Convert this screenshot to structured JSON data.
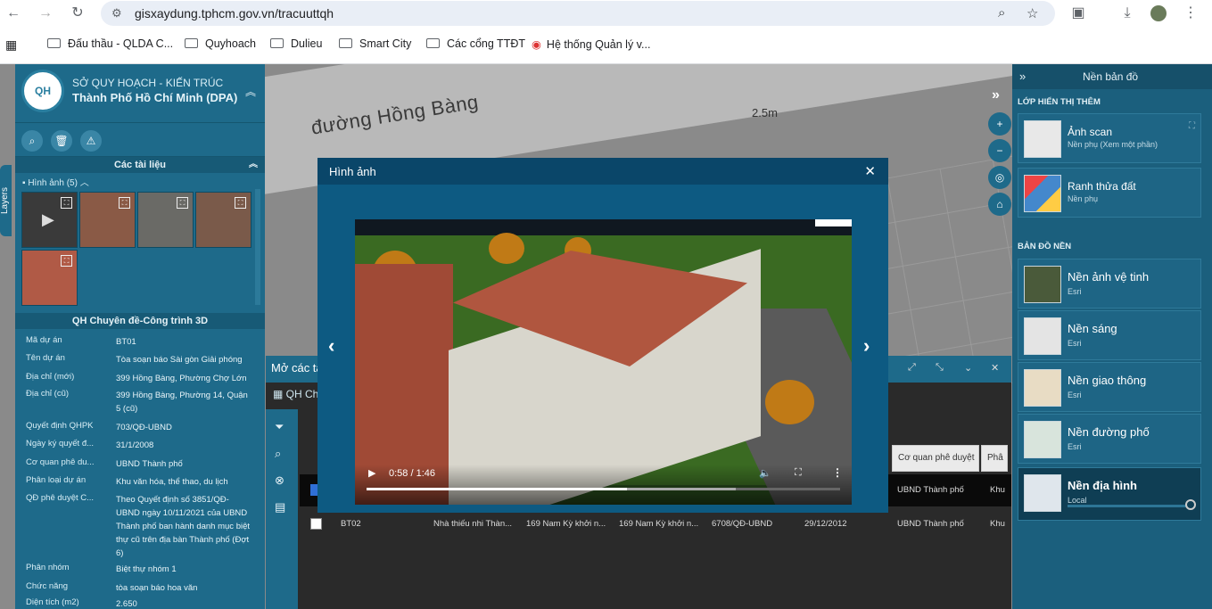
{
  "browser": {
    "url": "gisxaydung.tphcm.gov.vn/tracuuttqh",
    "bookmarks": [
      "Đấu thầu - QLDA C...",
      "Quyhoach",
      "Dulieu",
      "Smart City",
      "Các cổng TTĐT",
      "Hệ thống Quản lý v..."
    ]
  },
  "map": {
    "street_label": "đường Hồng Bàng",
    "distance_label": "2.5m"
  },
  "left_panel": {
    "org_line1": "SỞ QUY HOẠCH - KIẾN TRÚC",
    "org_line2": "Thành Phố Hồ Chí Minh (DPA)",
    "section_docs": "Các tài liệu",
    "images_label": "Hình ảnh (5)",
    "section_3d": "QH Chuyên đề-Công trình 3D",
    "rows": [
      {
        "k": "Mã dự án",
        "v": "BT01"
      },
      {
        "k": "Tên dự án",
        "v": "Tòa soạn báo Sài gòn Giải phóng"
      },
      {
        "k": "Địa chỉ (mới)",
        "v": "399 Hồng Bàng, Phường Chợ Lớn"
      },
      {
        "k": "Địa chỉ (cũ)",
        "v": "399 Hồng Bàng, Phường 14, Quận 5 (cũ)"
      },
      {
        "k": "Quyết định QHPK",
        "v": "703/QĐ-UBND"
      },
      {
        "k": "Ngày ký quyết đ...",
        "v": "31/1/2008"
      },
      {
        "k": "Cơ quan phê du...",
        "v": "UBND Thành phố"
      },
      {
        "k": "Phân loại dự án",
        "v": "Khu văn hóa, thể thao, du lịch"
      },
      {
        "k": "QĐ phê duyệt C...",
        "v": "Theo Quyết định số 3851/QĐ-UBND ngày 10/11/2021 của UBND Thành phố ban hành danh mục biệt thự cũ trên địa bàn Thành phố (Đợt 6)"
      },
      {
        "k": "Phân nhóm",
        "v": "Biệt thự nhóm 1"
      },
      {
        "k": "Chức năng",
        "v": "tòa soạn báo hoa văn"
      },
      {
        "k": "Diện tích (m2)",
        "v": "2.650"
      }
    ]
  },
  "layers_tab": "Layers",
  "right_panel": {
    "title": "Nền bản đồ",
    "extra_title": "LỚP HIỂN THỊ THÊM",
    "extra": [
      {
        "name": "Ảnh scan",
        "sub": "Nền phụ (Xem một phần)"
      },
      {
        "name": "Ranh thửa đất",
        "sub": "Nền phụ"
      }
    ],
    "base_title": "BẢN ĐỒ NỀN",
    "base": [
      {
        "name": "Nền ảnh vệ tinh",
        "sub": "Esri"
      },
      {
        "name": "Nền sáng",
        "sub": "Esri"
      },
      {
        "name": "Nền giao thông",
        "sub": "Esri"
      },
      {
        "name": "Nền đường phố",
        "sub": "Esri"
      },
      {
        "name": "Nền địa hình",
        "sub": "Local"
      }
    ]
  },
  "bottom_panel": {
    "title": "Mở các ta",
    "tab": "QH Chu",
    "headers": [
      "Cơ quan phê duyệt",
      "Phâ"
    ],
    "rows": [
      {
        "cells": [
          "",
          "",
          "",
          "",
          "",
          "",
          "UBND Thành phố",
          "Khu"
        ],
        "checked": true
      },
      {
        "cells": [
          "BT02",
          "Nhà thiếu nhi Thàn...",
          "169 Nam Kỳ khởi n...",
          "169 Nam Kỳ khởi n...",
          "6708/QĐ-UBND",
          "29/12/2012",
          "UBND Thành phố",
          "Khu"
        ],
        "checked": false
      }
    ]
  },
  "modal": {
    "title": "Hình ảnh",
    "video_time": "0:58 / 1:46",
    "progress": 0.55,
    "buffered": 0.78
  }
}
